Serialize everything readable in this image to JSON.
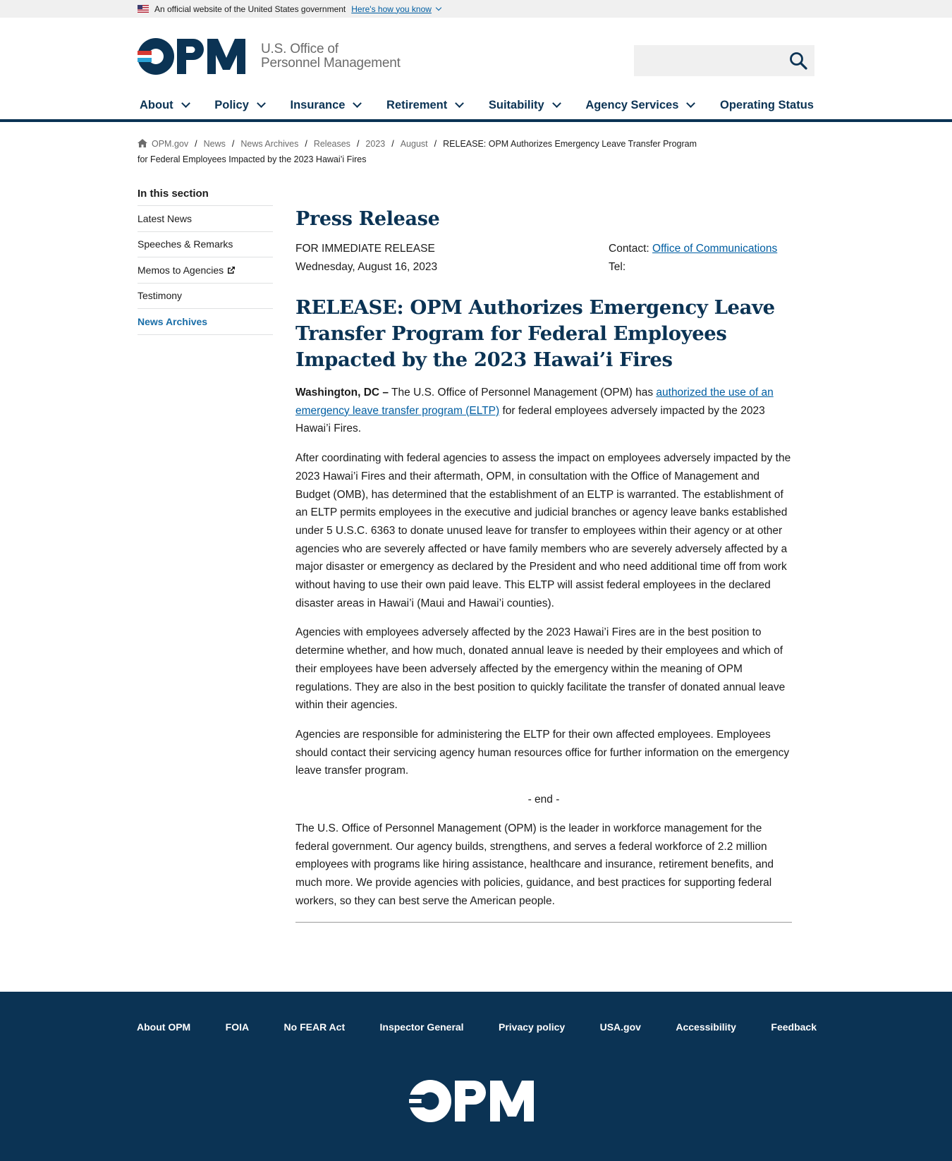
{
  "banner": {
    "text": "An official website of the United States government",
    "link": "Here's how you know"
  },
  "header": {
    "logo_text": "OPM",
    "agency_line1": "U.S. Office of",
    "agency_line2": "Personnel Management",
    "search": {
      "placeholder": "",
      "icon": "search-icon"
    }
  },
  "nav": {
    "items": [
      {
        "label": "About",
        "dropdown": true
      },
      {
        "label": "Policy",
        "dropdown": true
      },
      {
        "label": "Insurance",
        "dropdown": true
      },
      {
        "label": "Retirement",
        "dropdown": true
      },
      {
        "label": "Suitability",
        "dropdown": true
      },
      {
        "label": "Agency Services",
        "dropdown": true
      },
      {
        "label": "Operating Status",
        "dropdown": false
      }
    ]
  },
  "breadcrumb": {
    "items": [
      "OPM.gov",
      "News",
      "News Archives",
      "Releases",
      "2023",
      "August"
    ],
    "current": "RELEASE: OPM Authorizes Emergency Leave Transfer Program for Federal Employees Impacted by the 2023 Hawai’i Fires"
  },
  "sidebar": {
    "title": "In this section",
    "items": [
      {
        "label": "Latest News"
      },
      {
        "label": "Speeches & Remarks"
      },
      {
        "label": "Memos to Agencies"
      },
      {
        "label": "Testimony"
      },
      {
        "label": "News Archives"
      }
    ]
  },
  "main": {
    "page_title": "Press Release",
    "release_type": "FOR IMMEDIATE RELEASE",
    "date": "Wednesday, August 16, 2023",
    "contact_label": "Contact:",
    "contact_link": "Office of Communications",
    "tel_label": "Tel:",
    "headline": "RELEASE: OPM Authorizes Emergency Leave Transfer Program for Federal Employees Impacted by the 2023 Hawai’i Fires",
    "p1_dateline": "Washington, DC –",
    "p1_before": " The U.S. Office of Personnel Management (OPM) has ",
    "p1_link": "authorized the use of an emergency leave transfer program (ELTP)",
    "p1_after": " for federal employees adversely impacted by the 2023 Hawai’i Fires.",
    "p2": "After coordinating with federal agencies to assess the impact on employees adversely impacted by the 2023 Hawai’i Fires and their aftermath, OPM, in consultation with the Office of Management and Budget (OMB), has determined that the establishment of an ELTP is warranted. The establishment of an ELTP permits employees in the executive and judicial branches or agency leave banks established under 5 U.S.C. 6363 to donate unused leave for transfer to employees within their agency or at other agencies who are severely affected or have family members who are severely adversely affected by a major disaster or emergency as declared by the President and who need additional time off from work without having to use their own paid leave. This ELTP will assist federal employees in the declared disaster areas in Hawai’i (Maui and Hawai’i counties).",
    "p3": "Agencies with employees adversely affected by the 2023 Hawai’i Fires are in the best position to determine whether, and how much, donated annual leave is needed by their employees and which of their employees have been adversely affected by the emergency within the meaning of OPM regulations. They are also in the best position to quickly facilitate the transfer of donated annual leave within their agencies.",
    "p4": "Agencies are responsible for administering the ELTP for their own affected employees. Employees should contact their servicing agency human resources office for further information on the emergency leave transfer program.",
    "end": "- end -",
    "p5": "The U.S. Office of Personnel Management (OPM) is the leader in workforce management for the federal government. Our agency builds, strengthens, and serves a federal workforce of 2.2 million employees with programs like hiring assistance, healthcare and insurance, retirement benefits, and much more. We provide agencies with policies, guidance, and best practices for supporting federal workers, so they can best serve the American people."
  },
  "footer": {
    "links": [
      "About OPM",
      "FOIA",
      "No FEAR Act",
      "Inspector General",
      "Privacy policy",
      "USA.gov",
      "Accessibility",
      "Feedback"
    ],
    "logo_text": "OPM"
  },
  "colors": {
    "navy": "#0b3354",
    "link": "#005ea2",
    "logo_red": "#d83933",
    "logo_blue": "#2aa2d6"
  }
}
